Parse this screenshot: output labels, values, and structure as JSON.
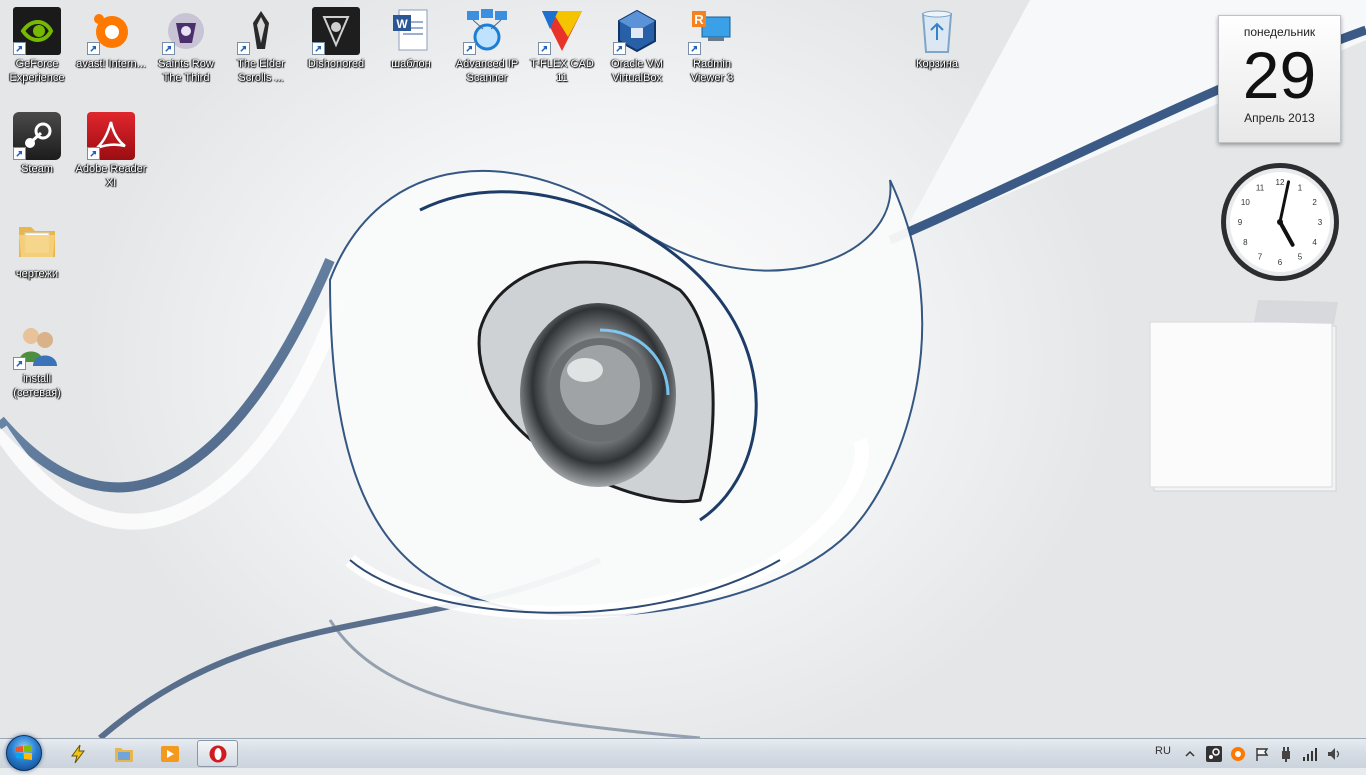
{
  "desktop": {
    "icons": [
      {
        "id": "geforce",
        "label": "GeForce Experience",
        "icon": "nvidia-icon",
        "color": "#76b900"
      },
      {
        "id": "avast",
        "label": "avast! Intern...",
        "icon": "avast-icon",
        "color": "#ff7800"
      },
      {
        "id": "saintsrow",
        "label": "Saints Row The Third",
        "icon": "saints-row-icon",
        "color": "#6b4b8f"
      },
      {
        "id": "skyrim",
        "label": "The Elder Scrolls ...",
        "icon": "skyrim-icon",
        "color": "#333333"
      },
      {
        "id": "dishonored",
        "label": "Dishonored",
        "icon": "dishonored-icon",
        "color": "#2a2a2a"
      },
      {
        "id": "shablon",
        "label": "шаблон",
        "icon": "word-document-icon",
        "color": "#2b5797"
      },
      {
        "id": "advancedip",
        "label": "Advanced IP Scanner",
        "icon": "network-scanner-icon",
        "color": "#1d7ed6"
      },
      {
        "id": "tflex",
        "label": "T-FLEX CAD 11",
        "icon": "tflex-icon",
        "color": "#e8332a"
      },
      {
        "id": "virtualbox",
        "label": "Oracle VM VirtualBox",
        "icon": "virtualbox-icon",
        "color": "#1b4f8f"
      },
      {
        "id": "radmin",
        "label": "Radmin Viewer 3",
        "icon": "radmin-icon",
        "color": "#d9531e"
      },
      {
        "id": "recycle",
        "label": "Корзина",
        "icon": "recycle-bin-icon",
        "color": "#7fa6c9"
      },
      {
        "id": "steam",
        "label": "Steam",
        "icon": "steam-icon",
        "color": "#2b2b2b"
      },
      {
        "id": "adobe",
        "label": "Adobe Reader XI",
        "icon": "adobe-reader-icon",
        "color": "#c4161c"
      },
      {
        "id": "chertezhi",
        "label": "чертежи",
        "icon": "folder-icon",
        "color": "#f2c86b"
      },
      {
        "id": "install",
        "label": "install (сетевая)",
        "icon": "network-users-icon",
        "color": "#4d8f3f"
      }
    ]
  },
  "gadgets": {
    "calendar": {
      "weekday": "понедельник",
      "date": "29",
      "month_year": "Апрель 2013"
    },
    "clock": {
      "hour": 5,
      "minute": 2,
      "numerals": [
        "12",
        "1",
        "2",
        "3",
        "4",
        "5",
        "6",
        "7",
        "8",
        "9",
        "10",
        "11"
      ]
    }
  },
  "taskbar": {
    "pinned": [
      {
        "id": "start",
        "icon": "windows-start-orb-icon"
      },
      {
        "id": "winamp",
        "icon": "lightning-app-icon"
      },
      {
        "id": "explorer",
        "icon": "explorer-folder-icon"
      },
      {
        "id": "media",
        "icon": "media-player-icon"
      },
      {
        "id": "opera",
        "icon": "opera-icon"
      }
    ],
    "tray": {
      "language": "RU",
      "icons": [
        "show-hidden-icons-chevron-icon",
        "steam-tray-icon",
        "avast-tray-icon",
        "action-center-flag-icon",
        "power-plug-icon",
        "network-signal-icon",
        "volume-icon"
      ]
    }
  }
}
